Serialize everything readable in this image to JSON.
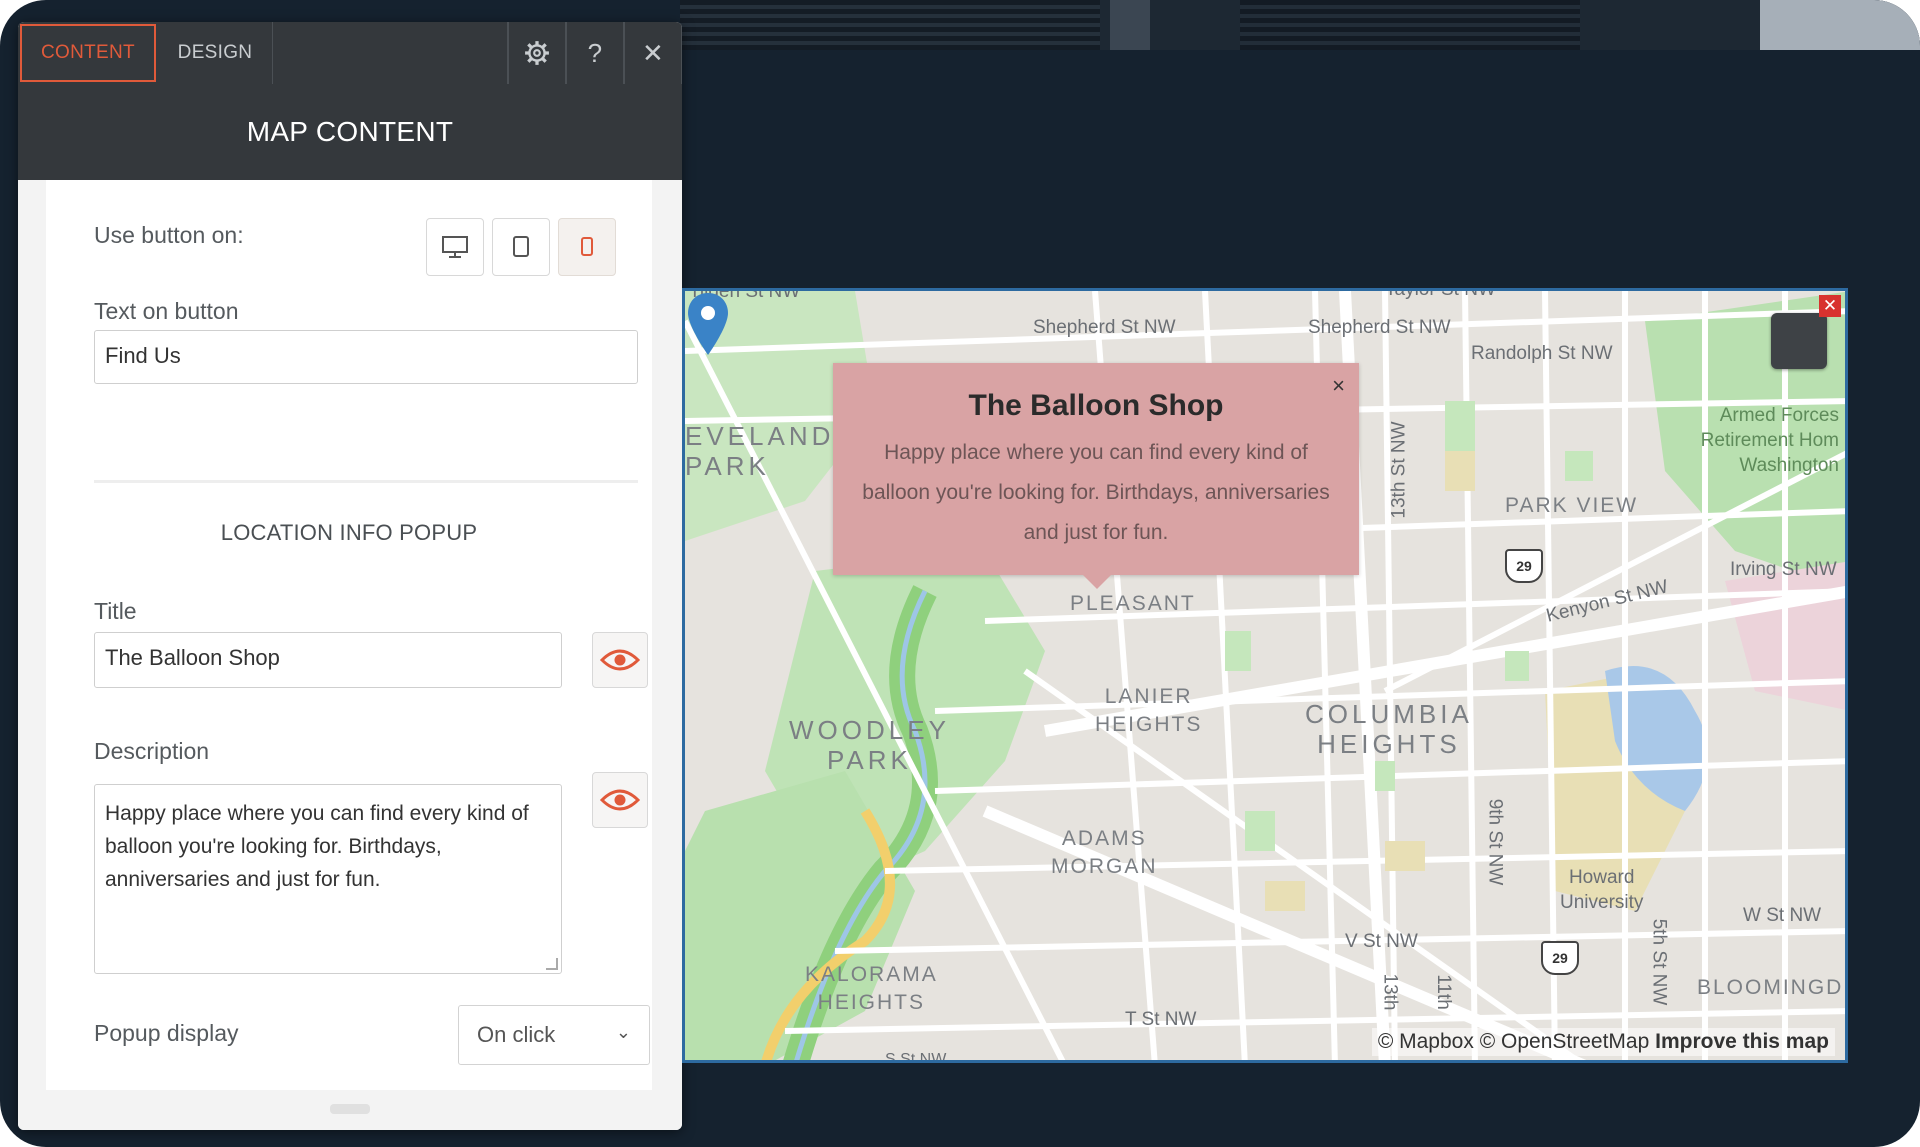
{
  "panel": {
    "tabs": {
      "content": "CONTENT",
      "design": "DESIGN",
      "settings_icon": "gear-icon",
      "help": "?",
      "close": "✕"
    },
    "header_title": "MAP CONTENT",
    "use_button_on_label": "Use button on:",
    "devices": [
      {
        "icon": "desktop-icon",
        "active": false
      },
      {
        "icon": "tablet-icon",
        "active": false
      },
      {
        "icon": "mobile-icon",
        "active": true
      }
    ],
    "text_on_button_label": "Text on button",
    "text_on_button_value": "Find Us",
    "section_title": "LOCATION INFO POPUP",
    "title_label": "Title",
    "title_value": "The Balloon Shop",
    "description_label": "Description",
    "description_value": "Happy place where you can find every kind of balloon you're looking for. Birthdays, anniversaries and just for fun.",
    "popup_display_label": "Popup display",
    "popup_display_value": "On click",
    "accent_color": "#e05a3a"
  },
  "map": {
    "popup": {
      "title": "The Balloon Shop",
      "description": "Happy place where you can find every kind of balloon you're looking for. Birthdays, anniversaries and just for fun.",
      "close": "×",
      "background": "#d9a3a4"
    },
    "labels": {
      "shepherd_1": "Shepherd St NW",
      "shepherd_2": "Shepherd St NW",
      "randolph": "Randolph St NW",
      "taylor": "Taylor St NW",
      "cleveland_1": "EVELAND",
      "cleveland_2": "PARK",
      "armed_forces_1": "Armed Forces",
      "armed_forces_2": "Retirement Hom",
      "armed_forces_3": "Washington",
      "park_view": "PARK VIEW",
      "irving": "Irving St NW",
      "kenyon": "Kenyon St NW",
      "st13": "13th St NW",
      "pleasant": "PLEASANT",
      "lanier_1": "LANIER",
      "lanier_2": "HEIGHTS",
      "columbia_1": "COLUMBIA",
      "columbia_2": "HEIGHTS",
      "woodley_1": "WOODLEY",
      "woodley_2": "PARK",
      "adams_1": "ADAMS",
      "adams_2": "MORGAN",
      "st9": "9th St NW",
      "howard_1": "Howard",
      "howard_2": "University",
      "w_st": "W St NW",
      "v_st": "V St NW",
      "st5": "5th St NW",
      "kalorama_1": "KALORAMA",
      "kalorama_2": "HEIGHTS",
      "t_st": "T St NW",
      "st13b": "13th",
      "st11": "11th",
      "bloomingdale": "BLOOMINGD",
      "s_st": "S St NW",
      "route_1": "29",
      "route_2": "29"
    },
    "attribution": {
      "mapbox": "© Mapbox",
      "osm": "© OpenStreetMap",
      "improve": "Improve this map"
    },
    "close": "✕"
  }
}
